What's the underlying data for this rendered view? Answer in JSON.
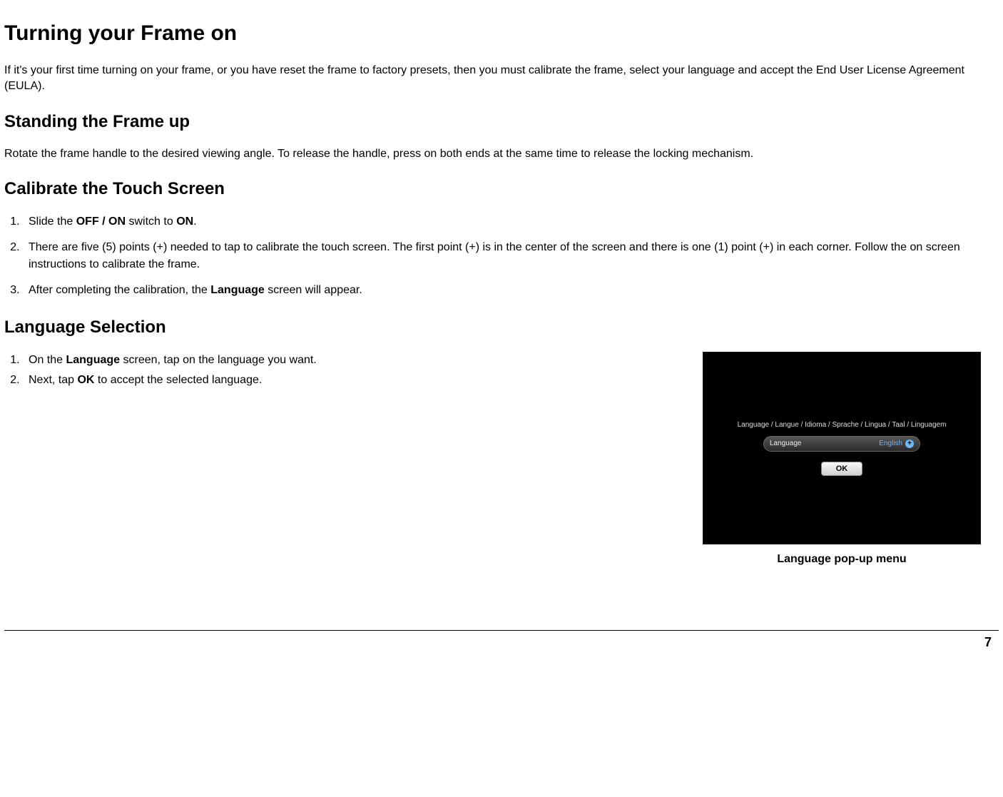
{
  "title": "Turning your Frame on",
  "intro": "If it's your first time turning on your frame, or you have reset the frame to factory presets, then you must calibrate the frame, select your language and accept the End User License Agreement (EULA).",
  "section_standing": {
    "heading": "Standing the Frame up",
    "body": "Rotate the frame handle to the desired viewing angle.  To release the handle, press on both ends at the same time to release the locking mechanism."
  },
  "section_calibrate": {
    "heading": "Calibrate the Touch Screen",
    "items": [
      {
        "pre": "Slide the ",
        "b1": "OFF / ON",
        "mid": " switch to ",
        "b2": "ON",
        "post": "."
      },
      {
        "text": "There are five (5) points (+) needed to tap to calibrate the touch screen.  The first point (+) is in the center of the screen and there is one (1) point (+) in each corner.  Follow the on screen instructions to calibrate the frame."
      },
      {
        "pre": "After completing the calibration, the ",
        "b1": "Language",
        "post": " screen will appear."
      }
    ]
  },
  "section_language": {
    "heading": "Language Selection",
    "items": [
      {
        "pre": "On the ",
        "b1": "Language",
        "post": " screen, tap on the language you want."
      },
      {
        "pre": "Next, tap ",
        "b1": "OK",
        "post": " to accept the selected language."
      }
    ]
  },
  "device": {
    "title_line": "Language / Langue / Idioma / Sprache / Lingua / Taal / Linguagem",
    "row_label": "Language",
    "row_value": "English",
    "ok_label": "OK"
  },
  "caption": "Language pop-up menu",
  "page_number": "7"
}
